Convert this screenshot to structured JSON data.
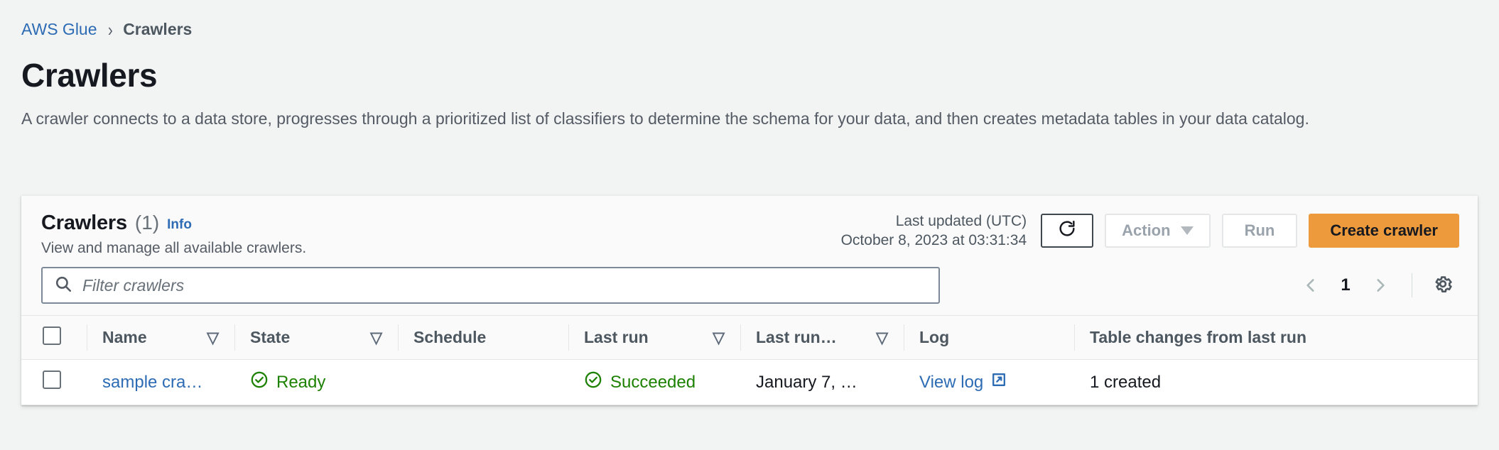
{
  "breadcrumb": {
    "root": "AWS Glue",
    "separator": "›",
    "current": "Crawlers"
  },
  "page": {
    "title": "Crawlers",
    "description": "A crawler connects to a data store, progresses through a prioritized list of classifiers to determine the schema for your data, and then creates metadata tables in your data catalog."
  },
  "panel": {
    "title": "Crawlers",
    "count": "(1)",
    "info_link": "Info",
    "subtitle": "View and manage all available crawlers.",
    "last_updated_label": "Last updated (UTC)",
    "last_updated_value": "October 8, 2023 at 03:31:34",
    "refresh_icon": "refresh-icon",
    "action_button": "Action",
    "run_button": "Run",
    "create_button": "Create crawler",
    "primary_color": "#ec9a3c"
  },
  "filter": {
    "search_icon": "search-icon",
    "placeholder": "Filter crawlers",
    "value": ""
  },
  "pagination": {
    "prev_icon": "chevron-left-icon",
    "page": "1",
    "next_icon": "chevron-right-icon",
    "settings_icon": "gear-icon"
  },
  "table": {
    "columns": [
      {
        "label": "",
        "sortable": false
      },
      {
        "label": "Name",
        "sortable": true
      },
      {
        "label": "State",
        "sortable": true
      },
      {
        "label": "Schedule",
        "sortable": false
      },
      {
        "label": "Last run",
        "sortable": true
      },
      {
        "label": "Last run…",
        "sortable": true
      },
      {
        "label": "Log",
        "sortable": false
      },
      {
        "label": "Table changes from last run",
        "sortable": false
      }
    ],
    "sort_glyph": "▽",
    "rows": [
      {
        "selected": false,
        "name": "sample cra…",
        "state": "Ready",
        "state_icon": "check-circle-icon",
        "schedule": "",
        "last_run": "Succeeded",
        "last_run_icon": "check-circle-icon",
        "last_run_time": "January 7, …",
        "log": "View log",
        "log_icon": "external-link-icon",
        "table_changes": "1 created"
      }
    ]
  },
  "colors": {
    "link": "#2d6cb4",
    "success": "#1d8102",
    "page_background": "#f2f3f3",
    "card_background": "#fafafa"
  }
}
